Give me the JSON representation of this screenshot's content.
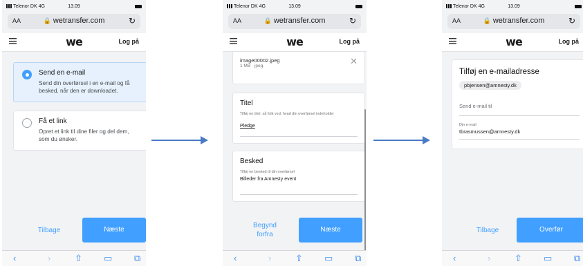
{
  "status": {
    "carrier": "Telenor DK 4G",
    "time": "13.09"
  },
  "browser": {
    "aa": "AA",
    "url": "wetransfer.com",
    "reload_icon": "reload-icon",
    "lock_icon": "lock-icon"
  },
  "nav": {
    "logo": "we",
    "login": "Log på"
  },
  "toolbar_icons": [
    "back-icon",
    "forward-icon",
    "share-icon",
    "bookmarks-icon",
    "tabs-icon"
  ],
  "screen1": {
    "options": [
      {
        "title": "Send en e-mail",
        "desc": "Send din overførsel i en e-mail og få besked, når den er downloadet.",
        "selected": true
      },
      {
        "title": "Få et link",
        "desc": "Opret et link til dine filer og del dem, som du ønsker.",
        "selected": false
      }
    ],
    "back": "Tilbage",
    "next": "Næste"
  },
  "screen2": {
    "file": {
      "name": "image00002.jpeg",
      "meta": "1 MB · jpeg"
    },
    "title_field": {
      "label": "Titel",
      "hint": "Tilføj en titel, så folk ved, hvad din overførsel indeholder",
      "value": "Pledge"
    },
    "message_field": {
      "label": "Besked",
      "hint": "Tilføj en besked til din overførsel",
      "value": "Billeder fra Amnesty event"
    },
    "start_over_line1": "Begynd",
    "start_over_line2": "forfra",
    "next": "Næste"
  },
  "screen3": {
    "heading": "Tilføj en e-mailadresse",
    "chip": "pbjensen@amnesty.dk",
    "send_to_placeholder": "Send e-mail til",
    "your_email_label": "Din e-mail",
    "your_email_value": "tbrasmussen@amnesty.dk",
    "back": "Tilbage",
    "transfer": "Overfør"
  },
  "colors": {
    "accent": "#409fff",
    "arrow": "#4a7ac4"
  }
}
